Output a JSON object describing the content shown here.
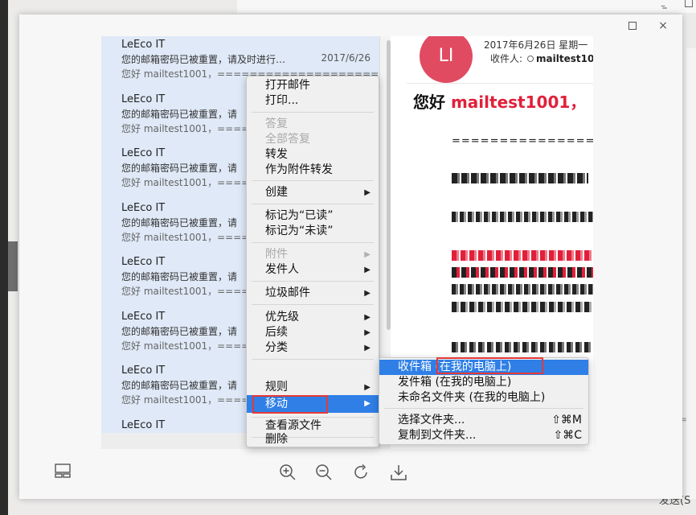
{
  "window": {
    "minimize": "–",
    "close": "×"
  },
  "mails": [
    {
      "sender": "LeEco IT",
      "subject": "您的邮箱密码已被重置，请及时进行…",
      "date": "2017/6/26",
      "preview": "您好 mailtest1001，===================="
    },
    {
      "sender": "LeEco IT",
      "subject": "您的邮箱密码已被重置，请",
      "preview": "您好 mailtest1001，===="
    },
    {
      "sender": "LeEco IT",
      "subject": "您的邮箱密码已被重置，请",
      "preview": "您好 mailtest1001，===="
    },
    {
      "sender": "LeEco IT",
      "subject": "您的邮箱密码已被重置，请",
      "preview": "您好 mailtest1001，===="
    },
    {
      "sender": "LeEco IT",
      "subject": "您的邮箱密码已被重置，请",
      "preview": "您好 mailtest1001，===="
    },
    {
      "sender": "LeEco IT",
      "subject": "您的邮箱密码已被重置，请",
      "preview": "您好 mailtest1001，===="
    },
    {
      "sender": "LeEco IT",
      "subject": "您的邮箱密码已被重置，请",
      "preview": "您好 mailtest1001，===="
    },
    {
      "sender": "LeEco IT",
      "subject": "",
      "preview": ""
    }
  ],
  "reader": {
    "avatar": "LI",
    "date": "2017年6月26日 星期一",
    "recipient_label": "收件人:",
    "recipient": "mailtest10",
    "greeting": "您好",
    "greeting_red": "mailtest1001，",
    "separator": "======================="
  },
  "context_menu": {
    "open": "打开邮件",
    "print": "打印...",
    "reply": "答复",
    "reply_all": "全部答复",
    "forward": "转发",
    "forward_attach": "作为附件转发",
    "create": "创建",
    "mark_read": "标记为“已读”",
    "mark_unread": "标记为“未读”",
    "attachments": "附件",
    "sender": "发件人",
    "junk": "垃圾邮件",
    "priority": "优先级",
    "follow_up": "后续",
    "categorize": "分类",
    "rules": "规则",
    "move": "移动",
    "view_source": "查看源文件",
    "delete": "删除",
    "arrow": "▶"
  },
  "submenu": {
    "inbox": "收件箱 (在我的电脑上)",
    "outbox": "发件箱 (在我的电脑上)",
    "unnamed": "未命名文件夹 (在我的电脑上)",
    "choose_folder": "选择文件夹...",
    "choose_shortcut": "⇧⌘M",
    "copy_folder": "复制到文件夹...",
    "copy_shortcut": "⇧⌘C"
  },
  "background": {
    "send_label": "发送(S"
  },
  "colors": {
    "accent": "#2f7fe6",
    "highlight_box": "#e53935",
    "avatar": "#e04b62",
    "list_bg": "#dfe9f7"
  }
}
